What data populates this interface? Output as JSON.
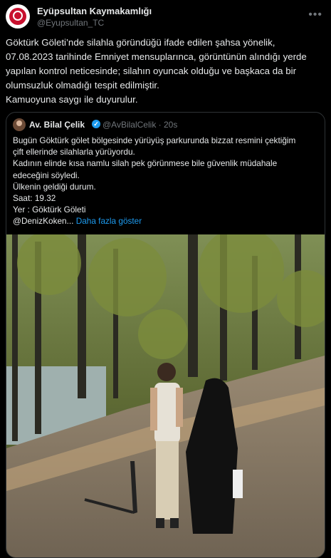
{
  "tweet": {
    "author_name": "Eyüpsultan Kaymakamlığı",
    "author_handle": "@Eyupsultan_TC",
    "more_icon": "more-horizontal-icon",
    "text_lines": [
      "Göktürk Göleti’nde silahla göründüğü ifade edilen şahsa yönelik,",
      "07.08.2023 tarihinde Emniyet mensuplarınca, görüntünün alındığı yerde",
      "yapılan kontrol neticesinde; silahın oyuncak olduğu ve başkaca da bir",
      "olumsuzluk olmadığı tespit edilmiştir.",
      "Kamuoyuna saygı ile duyurulur."
    ]
  },
  "quote": {
    "author_name": "Av. Bilal Çelik",
    "verified_icon": "verified-badge-icon",
    "author_handle": "@AvBilalCelik",
    "time": "· 20s",
    "lines": [
      "Bugün Göktürk gölet bölgesinde yürüyüş parkurunda bizzat resmini çektiğim",
      "çift ellerinde silahlarla yürüyordu.",
      "Kadının elinde kısa namlu silah pek görünmese bile güvenlik müdahale",
      "edeceğini söyledi.",
      "Ülkenin geldiği durum.",
      "Saat: 19.32",
      "Yer : Göktürk Göleti"
    ],
    "mention": "@DenizKoken...",
    "show_more": "Daha fazla göster"
  },
  "colors": {
    "background": "#000000",
    "text": "#e7e9ea",
    "muted": "#71767b",
    "link": "#1d9bf0",
    "border": "#2f3336"
  }
}
